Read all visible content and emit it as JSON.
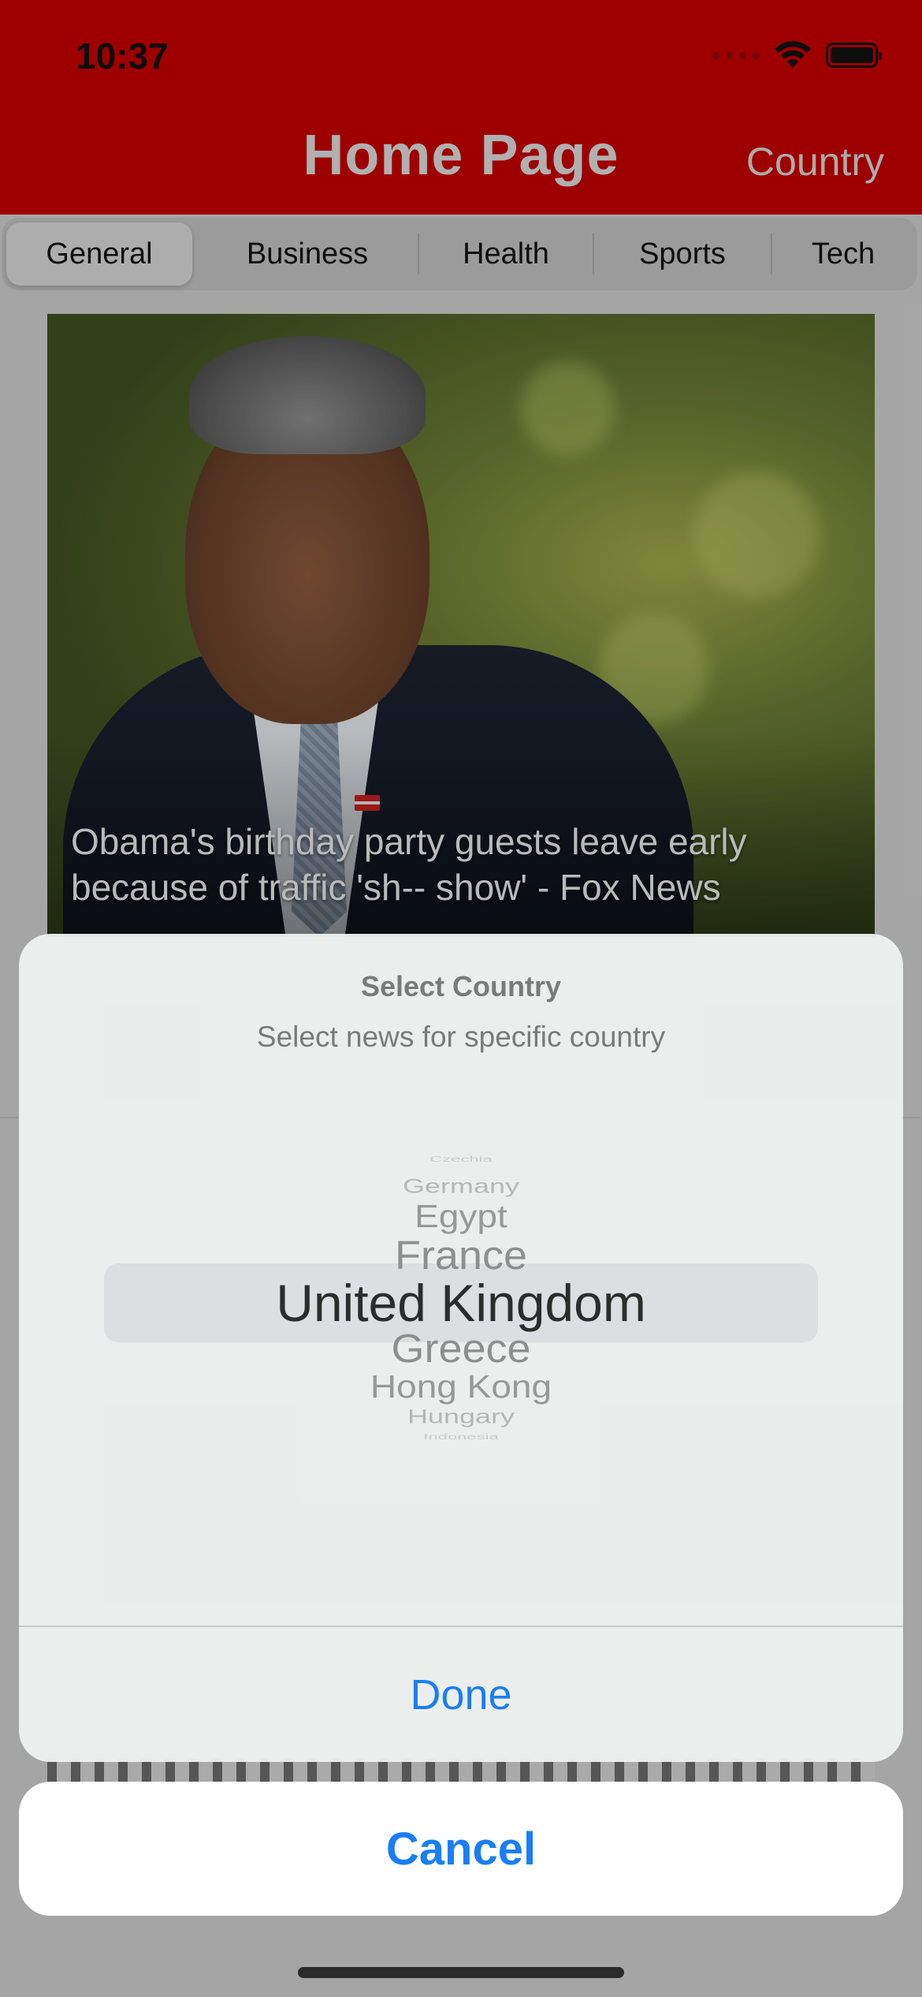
{
  "status_bar": {
    "time": "10:37"
  },
  "nav": {
    "title": "Home Page",
    "country_link": "Country"
  },
  "tabs": [
    {
      "label": "General",
      "active": true
    },
    {
      "label": "Business",
      "active": false
    },
    {
      "label": "Health",
      "active": false
    },
    {
      "label": "Sports",
      "active": false
    },
    {
      "label": "Tech",
      "active": false
    }
  ],
  "article": {
    "headline": "Obama's birthday party guests leave early because of traffic 'sh-- show' - Fox News"
  },
  "action_sheet": {
    "title": "Select Country",
    "subtitle": "Select news for specific country",
    "picker": {
      "items": [
        "Czechia",
        "Germany",
        "Egypt",
        "France",
        "United Kingdom",
        "Greece",
        "Hong Kong",
        "Hungary",
        "Indonesia"
      ],
      "selected": "United Kingdom"
    },
    "done_label": "Done",
    "cancel_label": "Cancel"
  },
  "colors": {
    "header_red": "#c60000",
    "accent_blue": "#1a7ef2"
  }
}
